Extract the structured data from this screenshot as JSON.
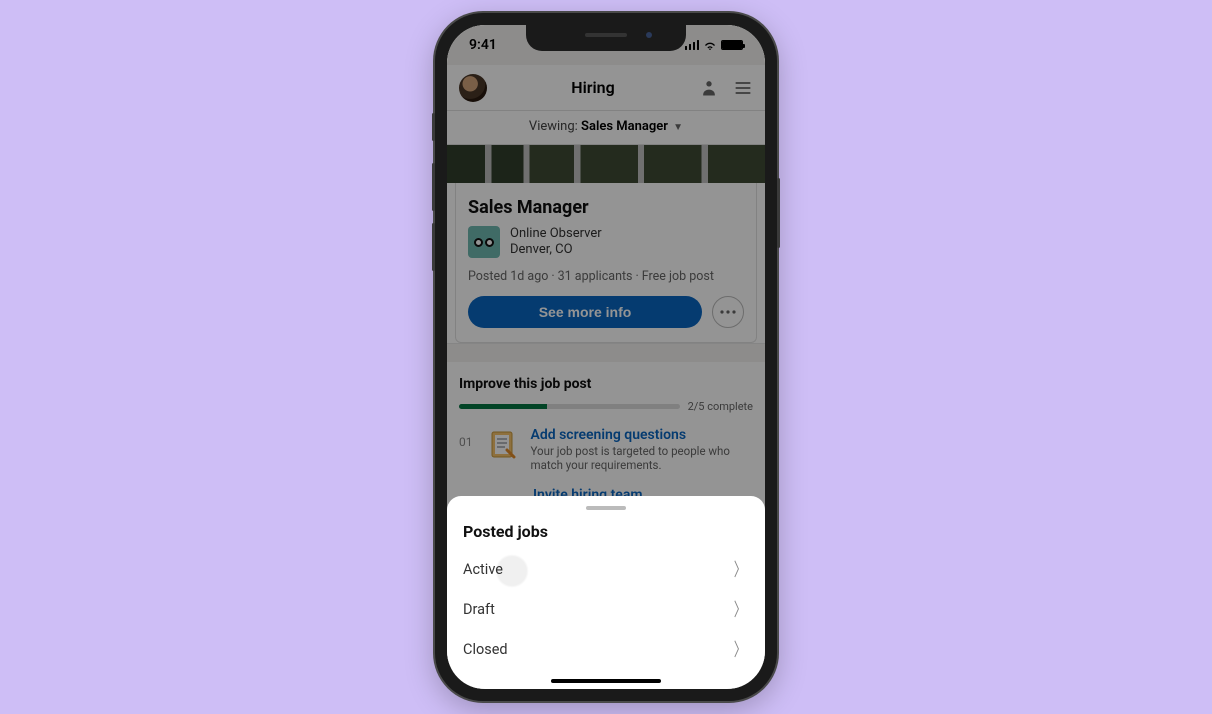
{
  "status": {
    "time": "9:41"
  },
  "topnav": {
    "title": "Hiring"
  },
  "viewing": {
    "label": "Viewing:",
    "value": "Sales Manager"
  },
  "job": {
    "title": "Sales Manager",
    "company": "Online Observer",
    "location": "Denver, CO",
    "posted": "Posted 1d ago",
    "applicants": "31 applicants",
    "plan": "Free job post",
    "see_more": "See more info"
  },
  "improve": {
    "heading": "Improve this job post",
    "progress_label": "2/5 complete",
    "progress_percent": 40,
    "items": [
      {
        "num": "01",
        "title": "Add screening questions",
        "desc": "Your job post is targeted to people who match your requirements."
      },
      {
        "num": "",
        "title": "Invite hiring team",
        "desc": ""
      }
    ]
  },
  "sheet": {
    "title": "Posted jobs",
    "options": [
      "Active",
      "Draft",
      "Closed"
    ]
  }
}
